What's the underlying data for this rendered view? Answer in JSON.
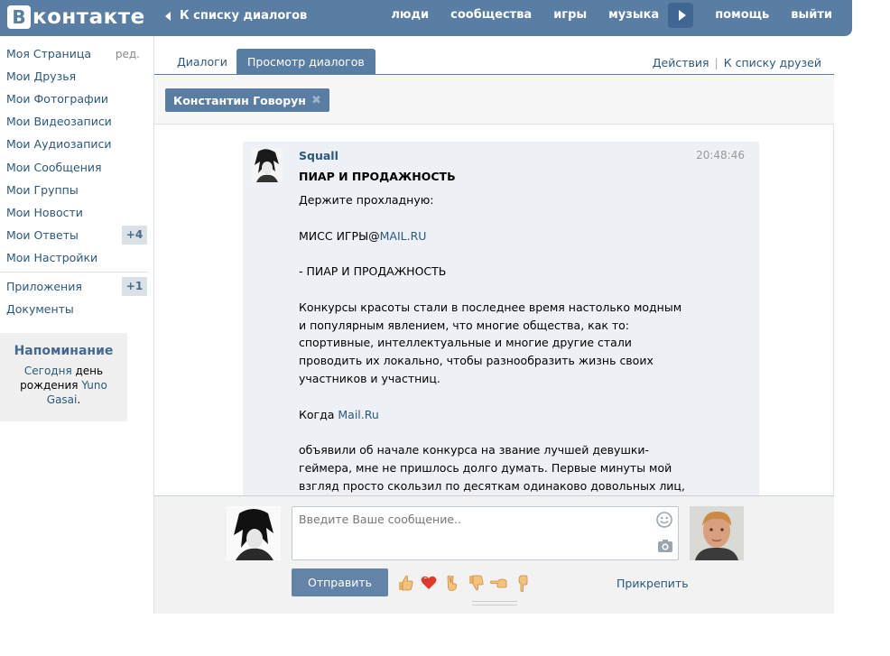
{
  "header": {
    "logo_text": "контакте",
    "logo_letter": "В",
    "back_link": "К списку диалогов",
    "nav": [
      "люди",
      "сообщества",
      "игры",
      "музыка",
      "помощь",
      "выйти"
    ]
  },
  "sidebar": {
    "items": [
      {
        "label": "Моя Страница",
        "extra": "ред."
      },
      {
        "label": "Мои Друзья"
      },
      {
        "label": "Мои Фотографии"
      },
      {
        "label": "Мои Видеозаписи"
      },
      {
        "label": "Мои Аудиозаписи"
      },
      {
        "label": "Мои Сообщения"
      },
      {
        "label": "Мои Группы"
      },
      {
        "label": "Мои Новости"
      },
      {
        "label": "Мои Ответы",
        "counter": "+4"
      },
      {
        "label": "Мои Настройки"
      }
    ],
    "items2": [
      {
        "label": "Приложения",
        "counter": "+1"
      },
      {
        "label": "Документы"
      }
    ],
    "reminder": {
      "title": "Напоминание",
      "today": "Сегодня",
      "text1": " день рождения ",
      "name": "Yuno Gasai",
      "dot": "."
    }
  },
  "tabs": {
    "dialogs": "Диалоги",
    "view_dialogs": "Просмотр диалогов",
    "actions": "Действия",
    "sep": "|",
    "to_friends": "К списку друзей"
  },
  "recipient": {
    "name": "Константин Говорун",
    "remove": "✖"
  },
  "message": {
    "author": "Squall",
    "time": "20:48:46",
    "subject": "ПИАР И ПРОДАЖНОСТЬ",
    "p1": "Держите прохладную:",
    "p2_text": "МИСС ИГРЫ@",
    "p2_link": "MAIL.RU",
    "p3": "- ПИАР И ПРОДАЖНОСТЬ",
    "p4": "Конкурсы красоты стали в последнее время настолько модным и популярным явлением, что многие общества, как то: спортивные, интеллектуальные и многие другие стали проводить их локально, чтобы разнообразить жизнь своих участников и участниц.",
    "p5_text": "Когда ",
    "p5_link": "Mail.Ru",
    "p6": "объявили об начале конкурса на звание лучшей девушки-геймера, мне не пришлось долго думать. Первые минуты мой взгляд просто скользил по десяткам одинаково довольных лиц, покрытых косметикой, ожидающих, что толпа обезумевших от гормонов"
  },
  "compose": {
    "placeholder": "Введите Ваше сообщение..",
    "send": "Отправить",
    "attach": "Прикрепить",
    "emojis": [
      "thumbs-up",
      "heart",
      "victory-hand",
      "thumbs-down",
      "pointing-left",
      "pointing-down"
    ]
  }
}
